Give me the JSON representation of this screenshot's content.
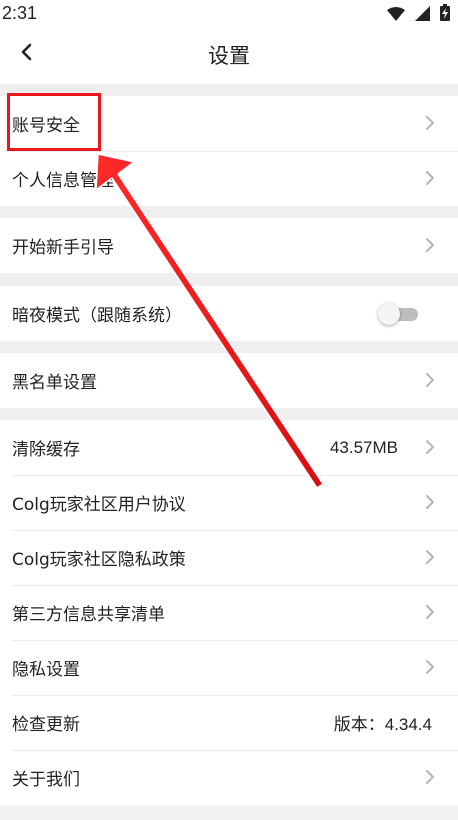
{
  "status_bar": {
    "time": "2:31",
    "icons": [
      "wifi-icon",
      "signal-icon",
      "battery-charging-icon"
    ]
  },
  "header": {
    "title": "设置",
    "back_icon": "chevron-left-icon"
  },
  "groups": {
    "account": [
      {
        "label": "账号安全",
        "chevron": "chevron-right-icon"
      },
      {
        "label": "个人信息管理",
        "chevron": "chevron-right-icon"
      }
    ],
    "guide": [
      {
        "label": "开始新手引导",
        "chevron": "chevron-right-icon"
      }
    ],
    "night": [
      {
        "label": "暗夜模式（跟随系统）",
        "toggle": false
      }
    ],
    "blacklist": [
      {
        "label": "黑名单设置",
        "chevron": "chevron-right-icon"
      }
    ],
    "misc": [
      {
        "label": "清除缓存",
        "value": "43.57MB",
        "chevron": "chevron-right-icon"
      },
      {
        "label": "Colg玩家社区用户协议",
        "chevron": "chevron-right-icon"
      },
      {
        "label": "Colg玩家社区隐私政策",
        "chevron": "chevron-right-icon"
      },
      {
        "label": "第三方信息共享清单",
        "chevron": "chevron-right-icon"
      },
      {
        "label": "隐私设置",
        "chevron": "chevron-right-icon"
      },
      {
        "label": "检查更新",
        "value": "版本：4.34.4",
        "chevron": "chevron-right-icon"
      },
      {
        "label": "关于我们",
        "chevron": "chevron-right-icon"
      }
    ]
  },
  "annotation": {
    "color": "#e8171e",
    "target": "账号安全"
  }
}
